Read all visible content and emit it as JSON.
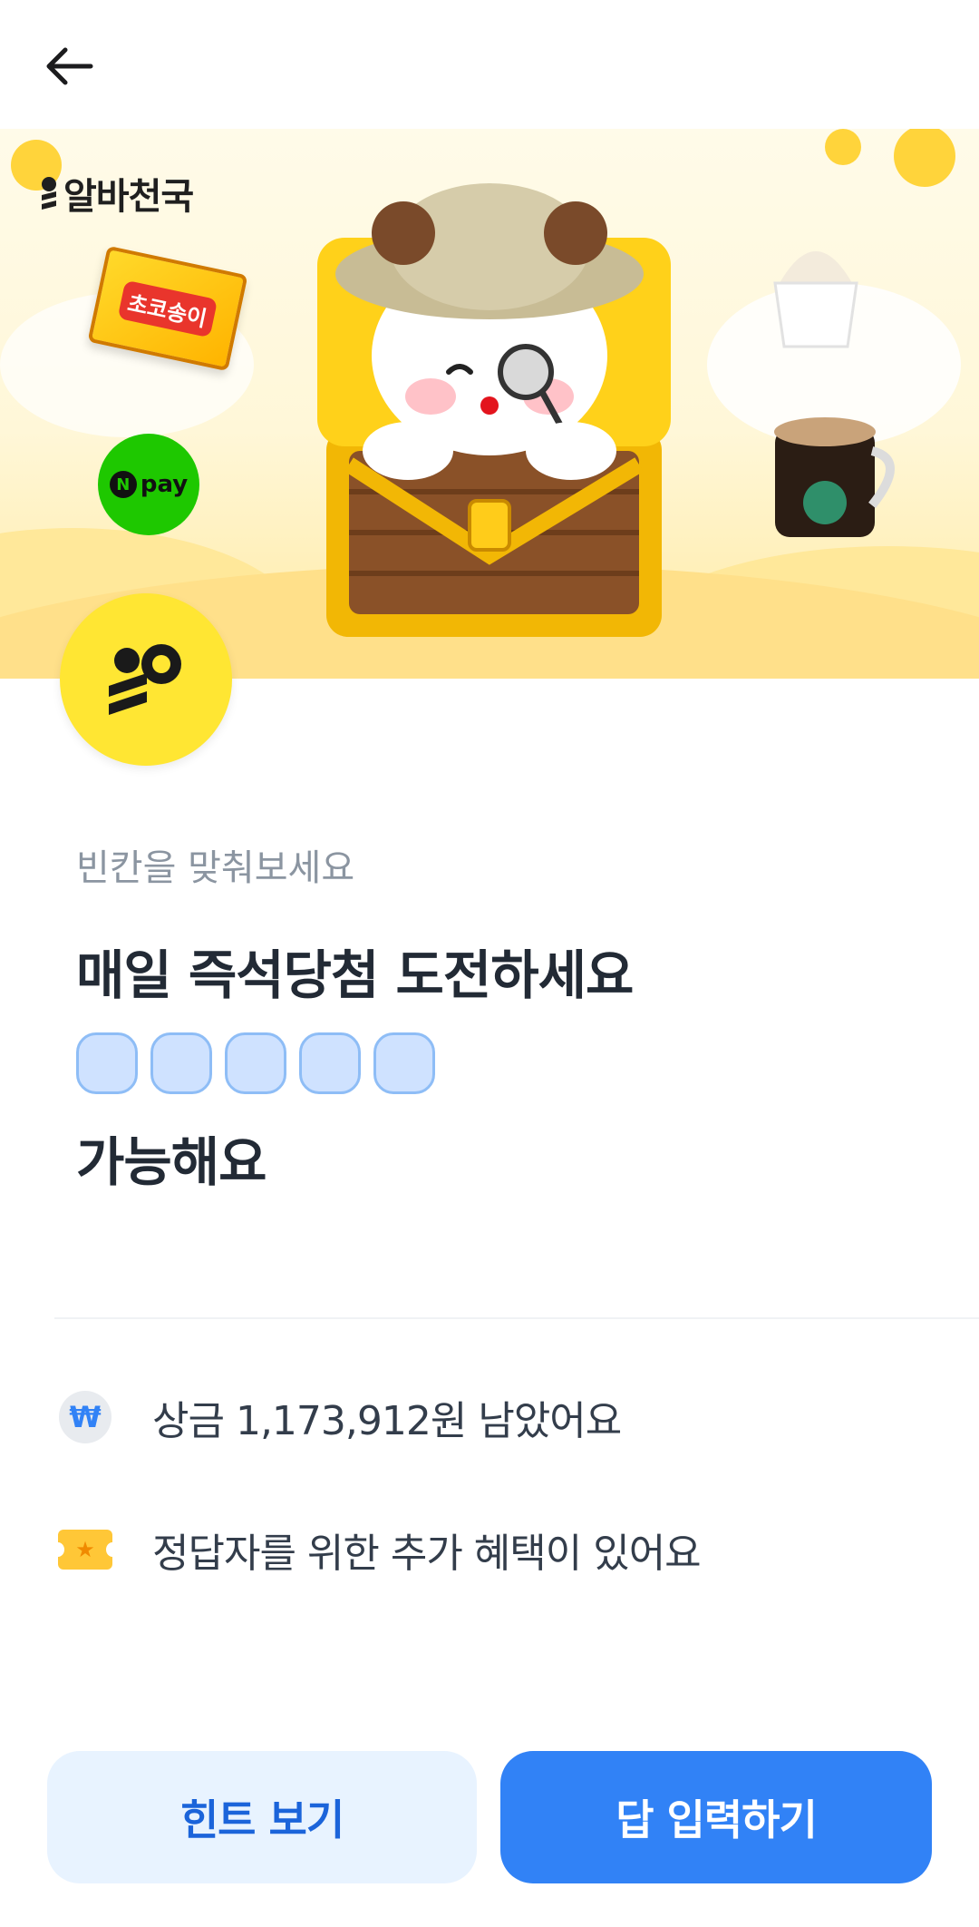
{
  "header": {
    "back_icon": "arrow-left-icon"
  },
  "banner": {
    "brand": "알바천국",
    "snack_label": "초코송이",
    "npay_label": "pay",
    "npay_badge": "N"
  },
  "quiz": {
    "subtitle": "빈칸을 맞춰보세요",
    "title_line1": "매일 즉석당첨 도전하세요",
    "blank_count": 5,
    "title_line2": "가능해요"
  },
  "info": {
    "prize_icon_text": "₩",
    "prize_text": "상금 1,173,912원 남았어요",
    "bonus_icon_text": "★",
    "bonus_text": "정답자를 위한 추가 혜택이 있어요"
  },
  "buttons": {
    "hint_label": "힌트 보기",
    "answer_label": "답 입력하기"
  },
  "colors": {
    "primary": "#3182f6",
    "primary_light": "#e8f3ff",
    "coin_yellow": "#ffe633",
    "banner_bg": "#fff7d8"
  }
}
